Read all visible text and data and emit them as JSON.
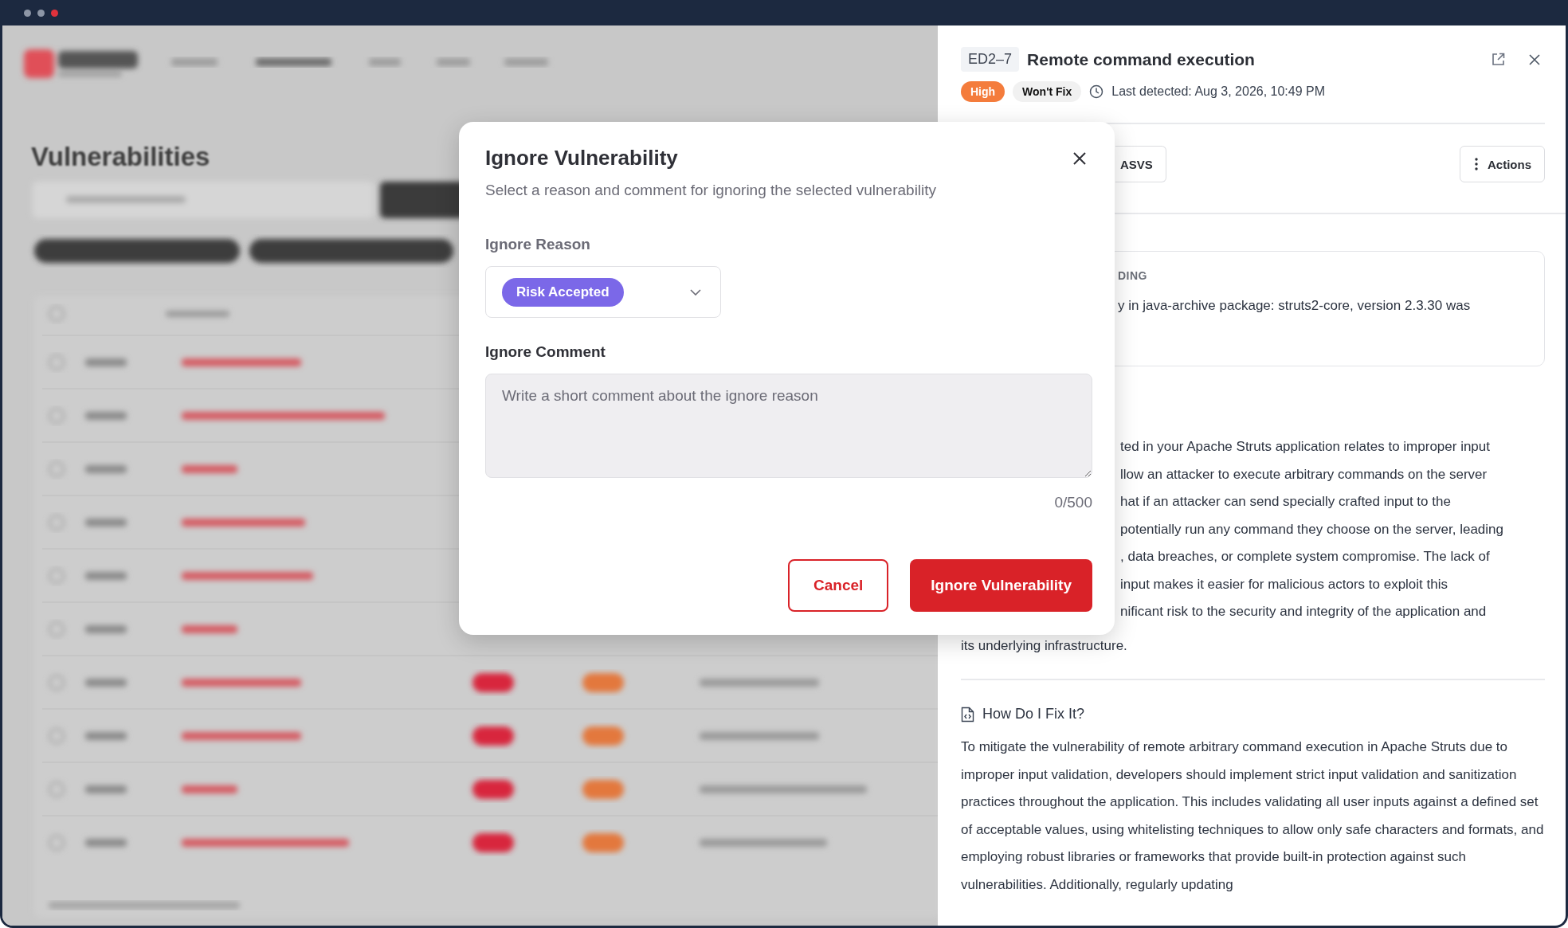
{
  "window": {
    "dots": [
      {
        "color": "#8d96a6"
      },
      {
        "color": "#8d96a6"
      },
      {
        "color": "#e0323c"
      }
    ]
  },
  "background_page": {
    "title": "Vulnerabilities"
  },
  "detail_panel": {
    "id": "ED2–7",
    "title": "Remote command execution",
    "severity": "High",
    "status": "Won't Fix",
    "last_detected": "Last detected: Aug 3, 2026, 10:49 PM",
    "tab_button": "ASVS",
    "actions_button": "Actions",
    "finding": {
      "label": "DING",
      "text": "y in java-archive package: struts2-core, version 2.3.30 was"
    },
    "description_lines": [
      "ted in your Apache Struts application relates to improper input",
      "llow an attacker to execute arbitrary commands on the server",
      "hat if an attacker can send specially crafted input to the",
      "potentially run any command they choose on the server, leading",
      ", data breaches, or complete system compromise. The lack of",
      "input makes it easier for malicious actors to exploit this",
      "nificant risk to the security and integrity of the application and"
    ],
    "description_last_line": "its underlying infrastructure.",
    "fix": {
      "heading": "How Do I Fix It?",
      "text": "To mitigate the vulnerability of remote arbitrary command execution in Apache Struts due to improper input validation, developers should implement strict input validation and sanitization practices throughout the application. This includes validating all user inputs against a defined set of acceptable values, using whitelisting techniques to allow only safe characters and formats, and employing robust libraries or frameworks that provide built-in protection against such vulnerabilities. Additionally, regularly updating"
    }
  },
  "dialog": {
    "title": "Ignore Vulnerability",
    "subtitle": "Select a reason and comment for ignoring the selected vulnerability",
    "reason_label": "Ignore Reason",
    "reason_value": "Risk Accepted",
    "comment_label": "Ignore Comment",
    "comment_placeholder": "Write a short comment about the ignore reason",
    "counter": "0/500",
    "buttons": [
      {
        "label": "Cancel",
        "kind": "secondary"
      },
      {
        "label": "Ignore Vulnerability",
        "kind": "primary"
      }
    ]
  }
}
